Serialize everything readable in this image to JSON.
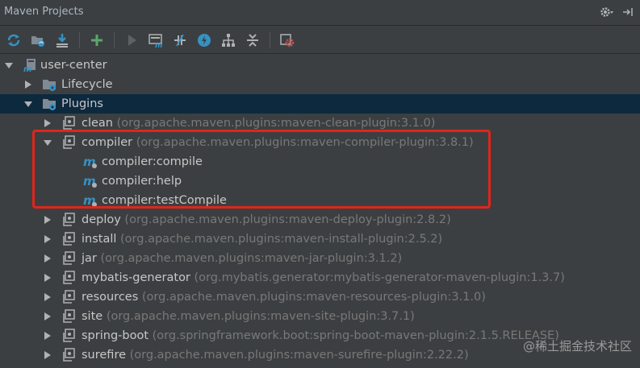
{
  "window": {
    "title": "Maven Projects"
  },
  "toolbar": {
    "buttons": [
      {
        "name": "reimport-icon"
      },
      {
        "name": "generate-sources-icon"
      },
      {
        "name": "download-sources-icon"
      },
      {
        "name": "add-project-icon"
      },
      {
        "name": "run-icon"
      },
      {
        "name": "execute-goal-icon"
      },
      {
        "name": "toggle-offline-icon"
      },
      {
        "name": "skip-tests-icon"
      },
      {
        "name": "show-dependencies-icon"
      },
      {
        "name": "collapse-all-icon"
      },
      {
        "name": "maven-settings-icon"
      }
    ]
  },
  "tree": {
    "root": "user-center",
    "lifecycle": "Lifecycle",
    "plugins": "Plugins",
    "plugin_items": [
      {
        "name": "clean",
        "detail": "(org.apache.maven.plugins:maven-clean-plugin:3.1.0)"
      },
      {
        "name": "compiler",
        "detail": "(org.apache.maven.plugins:maven-compiler-plugin:3.8.1)"
      },
      {
        "name": "deploy",
        "detail": "(org.apache.maven.plugins:maven-deploy-plugin:2.8.2)"
      },
      {
        "name": "install",
        "detail": "(org.apache.maven.plugins:maven-install-plugin:2.5.2)"
      },
      {
        "name": "jar",
        "detail": "(org.apache.maven.plugins:maven-jar-plugin:3.1.2)"
      },
      {
        "name": "mybatis-generator",
        "detail": "(org.mybatis.generator:mybatis-generator-maven-plugin:1.3.7)"
      },
      {
        "name": "resources",
        "detail": "(org.apache.maven.plugins:maven-resources-plugin:3.1.0)"
      },
      {
        "name": "site",
        "detail": "(org.apache.maven.plugins:maven-site-plugin:3.7.1)"
      },
      {
        "name": "spring-boot",
        "detail": "(org.springframework.boot:spring-boot-maven-plugin:2.1.5.RELEASE)"
      },
      {
        "name": "surefire",
        "detail": "(org.apache.maven.plugins:maven-surefire-plugin:2.22.2)"
      }
    ],
    "compiler_goals": [
      "compiler:compile",
      "compiler:help",
      "compiler:testCompile"
    ]
  },
  "watermark": "@稀土掘金技术社区",
  "colors": {
    "background": "#3c3f41",
    "selection": "#0d293e",
    "highlight": "#e1251b",
    "accent_blue": "#3592c4",
    "accent_green": "#59a869"
  }
}
